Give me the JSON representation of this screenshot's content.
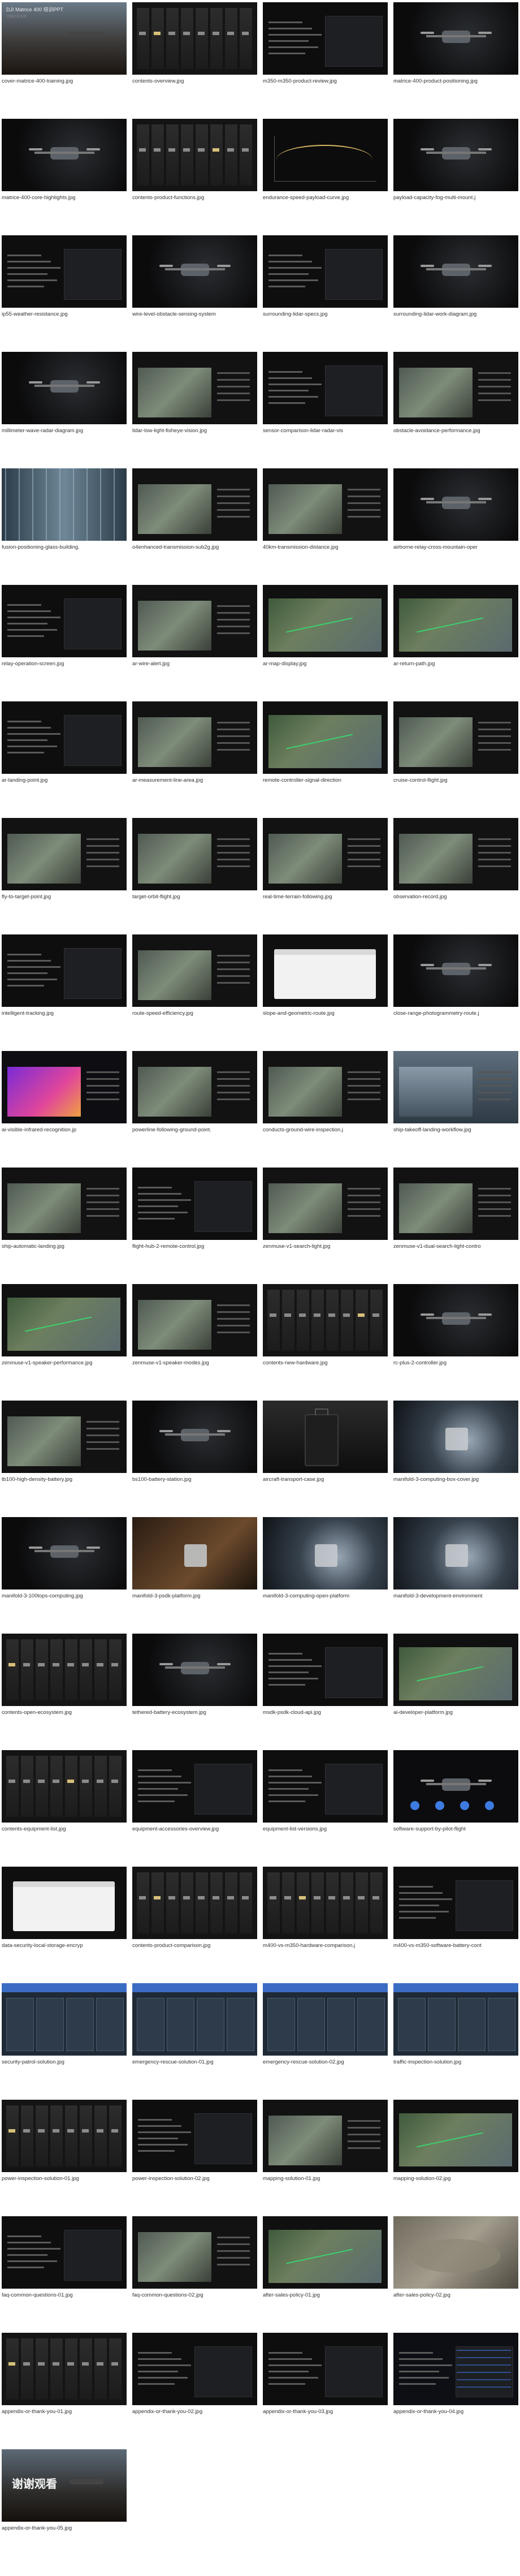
{
  "gallery": {
    "items": [
      {
        "label": "cover-matrice-400-training.jpg",
        "theme": "cover-dark",
        "title": "DJI Matrice 400 培训PPT",
        "subtitle": "大疆行业应用"
      },
      {
        "label": "contents-overview.jpg",
        "theme": "bars",
        "title": "",
        "subtitle": ""
      },
      {
        "label": "m350-m350-product-review.jpg",
        "theme": "dark-panel",
        "title": "",
        "subtitle": ""
      },
      {
        "label": "matrice-400-product-positioning.jpg",
        "theme": "dark-drone",
        "title": "",
        "subtitle": ""
      },
      {
        "label": "matrice-400-core-highlights.jpg",
        "theme": "dark-drone",
        "title": "",
        "subtitle": ""
      },
      {
        "label": "contents-product-functions.jpg",
        "theme": "bars",
        "title": "",
        "subtitle": ""
      },
      {
        "label": "endurance-speed-payload-curve.jpg",
        "theme": "dark-chart",
        "title": "",
        "subtitle": ""
      },
      {
        "label": "payload-capacity-fog-multi-mount.j",
        "theme": "dark-drone",
        "title": "",
        "subtitle": ""
      },
      {
        "label": "ip55-weather-resistance.jpg",
        "theme": "dark-text",
        "title": "",
        "subtitle": ""
      },
      {
        "label": "wire-level-obstacle-sensing-system",
        "theme": "dark-drone",
        "title": "",
        "subtitle": ""
      },
      {
        "label": "surrounding-lidar-specs.jpg",
        "theme": "dark-text",
        "title": "",
        "subtitle": ""
      },
      {
        "label": "surrounding-lidar-work-diagram.jpg",
        "theme": "dark-drone",
        "title": "",
        "subtitle": ""
      },
      {
        "label": "millimeter-wave-radar-diagram.jpg",
        "theme": "dark-drone",
        "title": "",
        "subtitle": ""
      },
      {
        "label": "lidar-low-light-fisheye-vision.jpg",
        "theme": "dark-photo",
        "title": "",
        "subtitle": ""
      },
      {
        "label": "sensor-comparison-lidar-radar-vis",
        "theme": "dark-text",
        "title": "",
        "subtitle": ""
      },
      {
        "label": "obstacle-avoidance-performance.jpg",
        "theme": "dark-photo",
        "title": "",
        "subtitle": ""
      },
      {
        "label": "fusion-positioning-glass-building.",
        "theme": "glass",
        "title": "",
        "subtitle": ""
      },
      {
        "label": "o4enhanced-transmission-sub2g.jpg",
        "theme": "dark-photo",
        "title": "",
        "subtitle": ""
      },
      {
        "label": "40km-transmission-distance.jpg",
        "theme": "dark-photo",
        "title": "",
        "subtitle": ""
      },
      {
        "label": "airborne-relay-cross-mountain-oper",
        "theme": "dark-drone",
        "title": "",
        "subtitle": ""
      },
      {
        "label": "relay-operation-screen.jpg",
        "theme": "dark-text",
        "title": "",
        "subtitle": ""
      },
      {
        "label": "ar-wire-alert.jpg",
        "theme": "dark-photo",
        "title": "",
        "subtitle": ""
      },
      {
        "label": "ar-map-display.jpg",
        "theme": "dark-map",
        "title": "",
        "subtitle": ""
      },
      {
        "label": "ar-return-path.jpg",
        "theme": "dark-map",
        "title": "",
        "subtitle": ""
      },
      {
        "label": "ar-landing-point.jpg",
        "theme": "dark-text",
        "title": "",
        "subtitle": ""
      },
      {
        "label": "ar-measurement-line-area.jpg",
        "theme": "dark-photo",
        "title": "",
        "subtitle": ""
      },
      {
        "label": "remote-controller-signal-direction",
        "theme": "dark-map",
        "title": "",
        "subtitle": ""
      },
      {
        "label": "cruise-control-flight.jpg",
        "theme": "dark-photo",
        "title": "",
        "subtitle": ""
      },
      {
        "label": "fly-to-target-point.jpg",
        "theme": "dark-photo",
        "title": "",
        "subtitle": ""
      },
      {
        "label": "target-orbit-flight.jpg",
        "theme": "dark-photo",
        "title": "",
        "subtitle": ""
      },
      {
        "label": "real-time-terrain-following.jpg",
        "theme": "dark-photo",
        "title": "",
        "subtitle": ""
      },
      {
        "label": "observation-record.jpg",
        "theme": "dark-photo",
        "title": "",
        "subtitle": ""
      },
      {
        "label": "intelligent-tracking.jpg",
        "theme": "dark-text",
        "title": "",
        "subtitle": ""
      },
      {
        "label": "route-speed-efficiency.jpg",
        "theme": "dark-photo",
        "title": "",
        "subtitle": ""
      },
      {
        "label": "slope-and-geometric-route.jpg",
        "theme": "light-ui",
        "title": "",
        "subtitle": ""
      },
      {
        "label": "close-range-photogrammetry-route.j",
        "theme": "dark-drone",
        "title": "",
        "subtitle": ""
      },
      {
        "label": "ai-visible-infrared-recognition.jp",
        "theme": "infrared",
        "title": "",
        "subtitle": ""
      },
      {
        "label": "powerline-following-ground-point.",
        "theme": "dark-photo",
        "title": "",
        "subtitle": ""
      },
      {
        "label": "conducts-ground-wire-inspection.j",
        "theme": "dark-photo",
        "title": "",
        "subtitle": ""
      },
      {
        "label": "ship-takeoff-landing-workflow.jpg",
        "theme": "sea",
        "title": "",
        "subtitle": ""
      },
      {
        "label": "ship-automatic-landing.jpg",
        "theme": "dark-photo",
        "title": "",
        "subtitle": ""
      },
      {
        "label": "flight-hub-2-remote-control.jpg",
        "theme": "dark-text",
        "title": "",
        "subtitle": ""
      },
      {
        "label": "zenmuse-v1-search-light.jpg",
        "theme": "dark-photo",
        "title": "",
        "subtitle": ""
      },
      {
        "label": "zenmuse-v1-dual-search-light-contro",
        "theme": "dark-photo",
        "title": "",
        "subtitle": ""
      },
      {
        "label": "zenmuse-v1-speaker-performance.jpg",
        "theme": "dark-map",
        "title": "",
        "subtitle": ""
      },
      {
        "label": "zenmuse-v1-speaker-modes.jpg",
        "theme": "dark-photo",
        "title": "",
        "subtitle": ""
      },
      {
        "label": "contents-new-hardware.jpg",
        "theme": "bars",
        "title": "",
        "subtitle": ""
      },
      {
        "label": "rc-plus-2-controller.jpg",
        "theme": "dark-drone",
        "title": "",
        "subtitle": ""
      },
      {
        "label": "tb100-high-density-battery.jpg",
        "theme": "dark-photo",
        "title": "",
        "subtitle": ""
      },
      {
        "label": "bs100-battery-station.jpg",
        "theme": "dark-drone",
        "title": "",
        "subtitle": ""
      },
      {
        "label": "aircraft-transport-case.jpg",
        "theme": "case",
        "title": "",
        "subtitle": ""
      },
      {
        "label": "manifold-3-computing-box-cover.jpg",
        "theme": "spot",
        "title": "",
        "subtitle": ""
      },
      {
        "label": "manifold-3-100tops-computing.jpg",
        "theme": "dark-drone",
        "title": "",
        "subtitle": ""
      },
      {
        "label": "manifold-3-psdk-platform.jpg",
        "theme": "brown",
        "title": "",
        "subtitle": ""
      },
      {
        "label": "manifold-3-computing-open-platform",
        "theme": "spot",
        "title": "",
        "subtitle": ""
      },
      {
        "label": "manifold-3-development-environment",
        "theme": "spot",
        "title": "",
        "subtitle": ""
      },
      {
        "label": "contents-open-ecosystem.jpg",
        "theme": "bars",
        "title": "",
        "subtitle": ""
      },
      {
        "label": "tethered-battery-ecosystem.jpg",
        "theme": "dark-drone",
        "title": "",
        "subtitle": ""
      },
      {
        "label": "msdk-psdk-cloud-api.jpg",
        "theme": "dark-text",
        "title": "",
        "subtitle": ""
      },
      {
        "label": "ai-developer-platform.jpg",
        "theme": "dark-map",
        "title": "",
        "subtitle": ""
      },
      {
        "label": "contents-equipment-list.jpg",
        "theme": "bars",
        "title": "",
        "subtitle": ""
      },
      {
        "label": "equipment-accessories-overview.jpg",
        "theme": "dark-text",
        "title": "",
        "subtitle": ""
      },
      {
        "label": "equipment-list-versions.jpg",
        "theme": "dark-text",
        "title": "",
        "subtitle": ""
      },
      {
        "label": "software-support-by-pilot-flight",
        "theme": "dark-icons",
        "title": "",
        "subtitle": ""
      },
      {
        "label": "data-security-local-storage-encryp",
        "theme": "light-ui",
        "title": "",
        "subtitle": ""
      },
      {
        "label": "contents-product-comparison.jpg",
        "theme": "bars",
        "title": "",
        "subtitle": ""
      },
      {
        "label": "m400-vs-m350-hardware-comparison.j",
        "theme": "bars",
        "title": "",
        "subtitle": ""
      },
      {
        "label": "m400-vs-m350-software-battery-cont",
        "theme": "dark-text",
        "title": "",
        "subtitle": ""
      },
      {
        "label": "security-patrol-solution.jpg",
        "theme": "solution",
        "title": "",
        "subtitle": ""
      },
      {
        "label": "emergency-rescue-solution-01.jpg",
        "theme": "solution",
        "title": "",
        "subtitle": ""
      },
      {
        "label": "emergency-rescue-solution-02.jpg",
        "theme": "solution",
        "title": "",
        "subtitle": ""
      },
      {
        "label": "traffic-inspection-solution.jpg",
        "theme": "solution",
        "title": "",
        "subtitle": ""
      },
      {
        "label": "power-inspection-solution-01.jpg",
        "theme": "bars",
        "title": "",
        "subtitle": ""
      },
      {
        "label": "power-inspection-solution-02.jpg",
        "theme": "dark-text",
        "title": "",
        "subtitle": ""
      },
      {
        "label": "mapping-solution-01.jpg",
        "theme": "dark-photo",
        "title": "",
        "subtitle": ""
      },
      {
        "label": "mapping-solution-02.jpg",
        "theme": "dark-map",
        "title": "",
        "subtitle": ""
      },
      {
        "label": "faq-common-questions-01.jpg",
        "theme": "dark-text",
        "title": "",
        "subtitle": ""
      },
      {
        "label": "faq-common-questions-02.jpg",
        "theme": "dark-photo",
        "title": "",
        "subtitle": ""
      },
      {
        "label": "after-sales-policy-01.jpg",
        "theme": "dark-map",
        "title": "",
        "subtitle": ""
      },
      {
        "label": "after-sales-policy-02.jpg",
        "theme": "terrain",
        "title": "",
        "subtitle": ""
      },
      {
        "label": "appendix-or-thank-you-01.jpg",
        "theme": "bars",
        "title": "",
        "subtitle": ""
      },
      {
        "label": "appendix-or-thank-you-02.jpg",
        "theme": "dark-text",
        "title": "",
        "subtitle": ""
      },
      {
        "label": "appendix-or-thank-you-03.jpg",
        "theme": "dark-text",
        "title": "",
        "subtitle": ""
      },
      {
        "label": "appendix-or-thank-you-04.jpg",
        "theme": "table",
        "title": "",
        "subtitle": ""
      },
      {
        "label": "appendix-or-thank-you-05.jpg",
        "theme": "thanks",
        "title": "谢谢观看",
        "subtitle": ""
      }
    ]
  }
}
